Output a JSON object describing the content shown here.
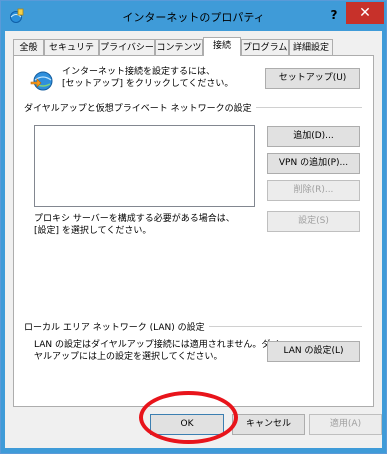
{
  "window": {
    "title": "インターネットのプロパティ",
    "help_label": "?",
    "close_label": "✕"
  },
  "tabs": [
    {
      "label": "全般"
    },
    {
      "label": "セキュリティ"
    },
    {
      "label": "プライバシー"
    },
    {
      "label": "コンテンツ"
    },
    {
      "label": "接続",
      "active": true
    },
    {
      "label": "プログラム"
    },
    {
      "label": "詳細設定"
    }
  ],
  "setup": {
    "text_line1": "インターネット接続を設定するには、",
    "text_line2": "[セットアップ] をクリックしてください。",
    "button_label": "セットアップ(U)"
  },
  "dialup": {
    "group_title": "ダイヤルアップと仮想プライベート ネットワークの設定",
    "add_label": "追加(D)...",
    "add_vpn_label": "VPN の追加(P)...",
    "remove_label": "削除(R)...",
    "settings_label": "設定(S)",
    "proxy_line1": "プロキシ サーバーを構成する必要がある場合は、",
    "proxy_line2": "[設定] を選択してください。"
  },
  "lan": {
    "group_title": "ローカル エリア ネットワーク (LAN) の設定",
    "text_line1": "LAN の設定はダイヤルアップ接続には適用されません。ダイ",
    "text_line2": "ヤルアップには上の設定を選択してください。",
    "button_label": "LAN の設定(L)"
  },
  "footer": {
    "ok_label": "OK",
    "cancel_label": "キャンセル",
    "apply_label": "適用(A)"
  },
  "colors": {
    "titlebar": "#3f9bd8",
    "close": "#c7312a",
    "highlight_ellipse": "#e8141b"
  }
}
